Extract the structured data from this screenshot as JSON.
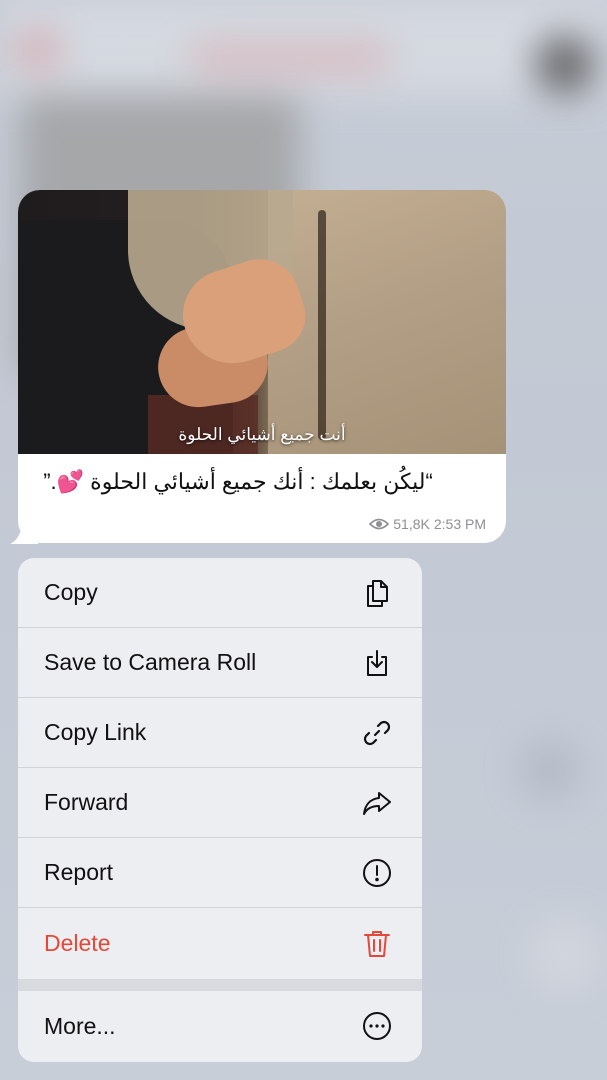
{
  "message": {
    "media_caption": "أنت جميع أشيائي الحلوة",
    "text": "“ليكُن بعلمك : أنك جميع أشيائي الحلوة 💕.”",
    "views": "51,8K",
    "time": "2:53 PM"
  },
  "menu": {
    "items": [
      {
        "label": "Copy",
        "icon": "copy-icon"
      },
      {
        "label": "Save to Camera Roll",
        "icon": "download-icon"
      },
      {
        "label": "Copy Link",
        "icon": "link-icon"
      },
      {
        "label": "Forward",
        "icon": "forward-icon"
      },
      {
        "label": "Report",
        "icon": "report-icon"
      },
      {
        "label": "Delete",
        "icon": "trash-icon"
      },
      {
        "label": "More...",
        "icon": "more-icon"
      }
    ]
  },
  "colors": {
    "danger": "#e5483b",
    "menu_bg": "#eeeff2"
  }
}
